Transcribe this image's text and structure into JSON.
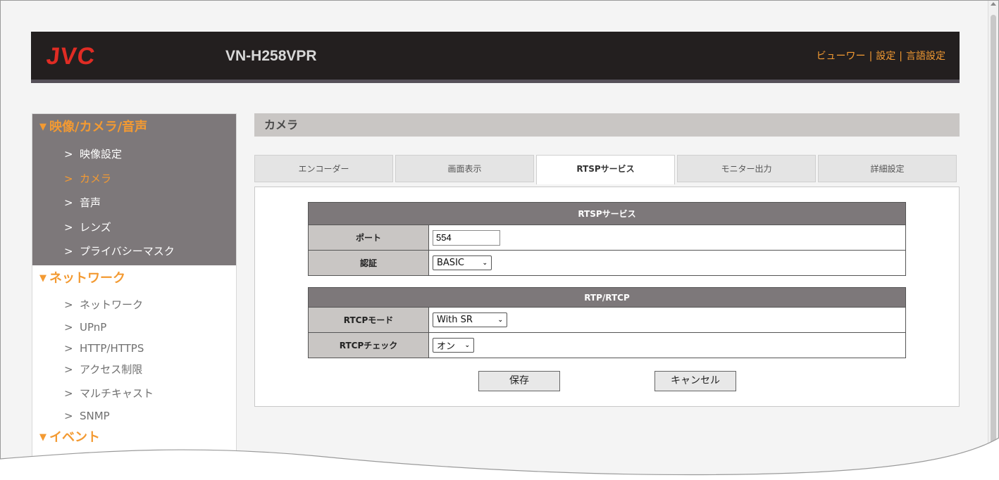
{
  "header": {
    "logo": "JVC",
    "model": "VN-H258VPR",
    "nav": [
      "ビューワー",
      "設定",
      "言語設定"
    ],
    "nav_sep": "|"
  },
  "sidebar": {
    "sections": [
      {
        "title": "映像/カメラ/音声",
        "items": [
          "映像設定",
          "カメラ",
          "音声",
          "レンズ",
          "プライバシーマスク"
        ],
        "active_item": "カメラ"
      },
      {
        "title": "ネットワーク",
        "items": [
          "ネットワーク",
          "UPnP",
          "HTTP/HTTPS",
          "アクセス制限",
          "マルチキャスト",
          "SNMP"
        ]
      },
      {
        "title": "イベント",
        "items": []
      }
    ],
    "arrow": ">",
    "triangle": "▼"
  },
  "main": {
    "title": "カメラ",
    "tabs": [
      "エンコーダー",
      "画面表示",
      "RTSPサービス",
      "モニター出力",
      "詳細設定"
    ],
    "active_tab": "RTSPサービス"
  },
  "rtsp": {
    "header": "RTSPサービス",
    "port_label": "ポート",
    "port_value": "554",
    "auth_label": "認証",
    "auth_value": "BASIC"
  },
  "rtp": {
    "header": "RTP/RTCP",
    "mode_label": "RTCPモード",
    "mode_value": "With SR",
    "check_label": "RTCPチェック",
    "check_value": "オン"
  },
  "buttons": {
    "save": "保存",
    "cancel": "キャンセル"
  },
  "colors": {
    "accent": "#f39a32",
    "logo_red": "#e02c24",
    "header_bg": "#231f1f",
    "sidebar_dark": "#7d787a"
  }
}
